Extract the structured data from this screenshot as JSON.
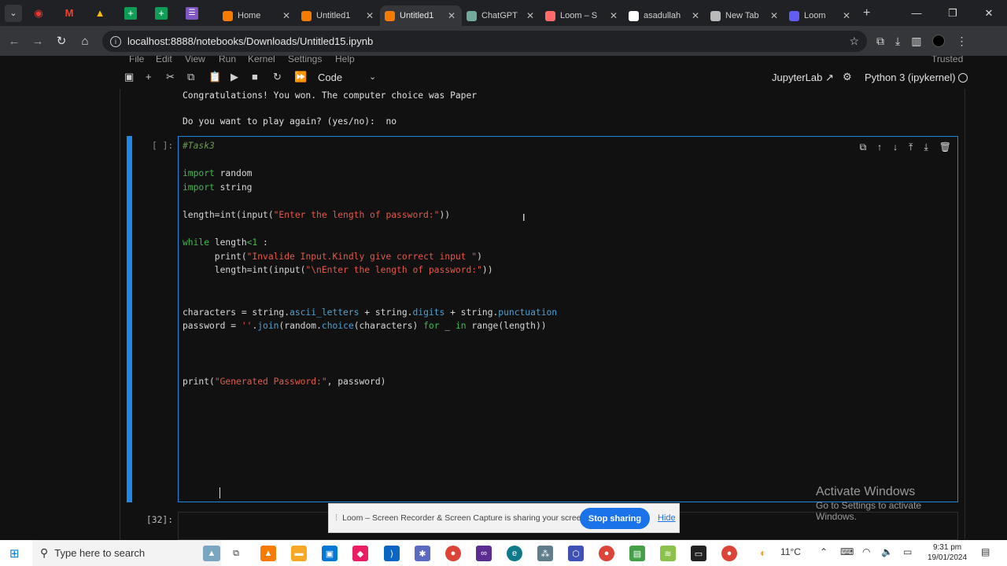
{
  "browser": {
    "tabs": [
      {
        "title": "Home",
        "color": "#f57c00"
      },
      {
        "title": "Untitled1",
        "color": "#f57c00"
      },
      {
        "title": "Untitled1",
        "color": "#f57c00",
        "active": true
      },
      {
        "title": "ChatGPT",
        "color": "#74aa9c"
      },
      {
        "title": "Loom – S",
        "color": "#ff6b6b"
      },
      {
        "title": "asadullah",
        "color": "#ffffff"
      },
      {
        "title": "New Tab",
        "color": "#bbbbbb"
      },
      {
        "title": "Loom",
        "color": "#625df5"
      }
    ],
    "url": "localhost:8888/notebooks/Downloads/Untitled15.ipynb"
  },
  "jupyter": {
    "menu": [
      "File",
      "Edit",
      "View",
      "Run",
      "Kernel",
      "Settings",
      "Help"
    ],
    "trusted": "Trusted",
    "cell_type": "Code",
    "jupyterlab_label": "JupyterLab",
    "kernel_label": "Python 3 (ipykernel)"
  },
  "output": {
    "line1": "Congratulations! You won. The computer choice was Paper",
    "line2": "Do you want to play again? (yes/no):  no"
  },
  "cell": {
    "prompt": "[ ]:",
    "code": {
      "l1": "#Task3",
      "l3_kw": "import",
      "l3_rest": " random",
      "l4_kw": "import",
      "l4_rest": " string",
      "l6_a": "length=int(input(",
      "l6_str": "\"Enter the length of password:\"",
      "l6_b": "))",
      "l8_kw": "while",
      "l8_a": " length",
      "l8_op": "<1",
      "l8_b": " :",
      "l9_a": "      print(",
      "l9_str": "\"Invalide Input.Kindly give correct input \"",
      "l9_b": ")",
      "l10_a": "      length=int(input(",
      "l10_str": "\"\\nEnter the length of password:\"",
      "l10_b": "))",
      "l13_a": "characters = string.",
      "l13_attr1": "ascii_letters",
      "l13_b": " + string.",
      "l13_attr2": "digits",
      "l13_c": " + string.",
      "l13_attr3": "punctuation",
      "l14_a": "password = ",
      "l14_str": "''",
      "l14_b": ".",
      "l14_attr": "join",
      "l14_c": "(random.",
      "l14_attr2": "choice",
      "l14_d": "(characters) ",
      "l14_kw": "for",
      "l14_e": " _ ",
      "l14_kw2": "in",
      "l14_f": " range(length))",
      "l18_a": "print(",
      "l18_str": "\"Generated Password:\"",
      "l18_b": ", password)"
    }
  },
  "next_cell": {
    "prompt": "[32]:"
  },
  "watermark": {
    "line1": "Activate Windows",
    "line2": "Go to Settings to activate Windows."
  },
  "loom_banner": {
    "message": "Loom – Screen Recorder & Screen Capture is sharing your screen.",
    "stop_label": "Stop sharing",
    "hide_label": "Hide"
  },
  "taskbar": {
    "search_placeholder": "Type here to search",
    "weather": "11°C",
    "time": "9:31 pm",
    "date": "19/01/2024"
  }
}
